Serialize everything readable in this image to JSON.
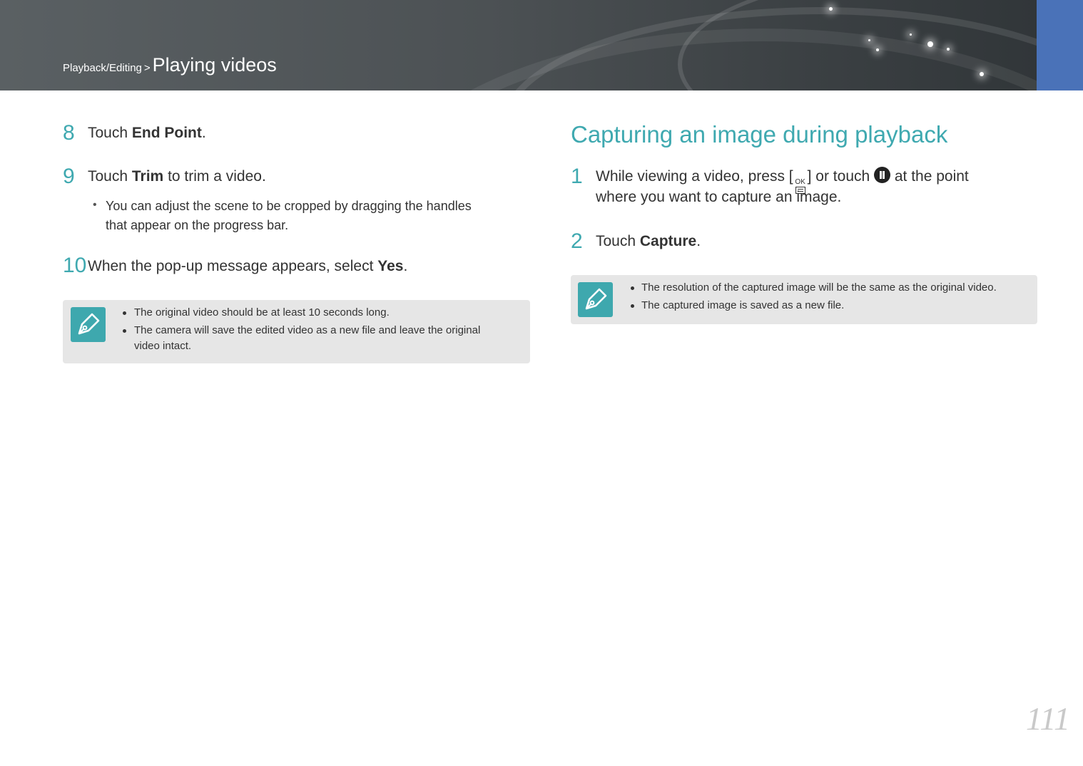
{
  "header": {
    "breadcrumb_parent": "Playback/Editing",
    "breadcrumb_separator": ">",
    "breadcrumb_current": "Playing videos"
  },
  "left_column": {
    "step8": {
      "number": "8",
      "prefix": "Touch ",
      "bold": "End Point",
      "suffix": "."
    },
    "step9": {
      "number": "9",
      "prefix": "Touch ",
      "bold": "Trim",
      "suffix": " to trim a video.",
      "bullet_line1": "You can adjust the scene to be cropped by dragging the handles",
      "bullet_line2": "that appear on the progress bar."
    },
    "step10": {
      "number": "10",
      "prefix": "When the pop-up message appears, select ",
      "bold": "Yes",
      "suffix": "."
    },
    "note": {
      "line1": "The original video should be at least 10 seconds long.",
      "line2": "The camera will save the edited video as a new file and leave the original",
      "line3": "video intact."
    }
  },
  "right_column": {
    "section_title": "Capturing an image during playback",
    "step1": {
      "number": "1",
      "text_a": "While viewing a video, press [",
      "ok_label": "OK",
      "text_b": "] or touch ",
      "text_c": " at the point",
      "line2": "where you want to capture an image."
    },
    "step2": {
      "number": "2",
      "prefix": "Touch ",
      "bold": "Capture",
      "suffix": "."
    },
    "note": {
      "line1": "The resolution of the captured image will be the same as the original video.",
      "line2": "The captured image is saved as a new file."
    }
  },
  "icons": {
    "note_icon": "pen-nib-icon",
    "ok_button_icon": "ok-menu-button-icon",
    "pause_icon": "pause-icon"
  },
  "colors": {
    "accent_teal": "#3fa9b0",
    "header_tab_blue": "#4a72b8",
    "note_background": "#e6e6e6"
  },
  "page_number": "111"
}
